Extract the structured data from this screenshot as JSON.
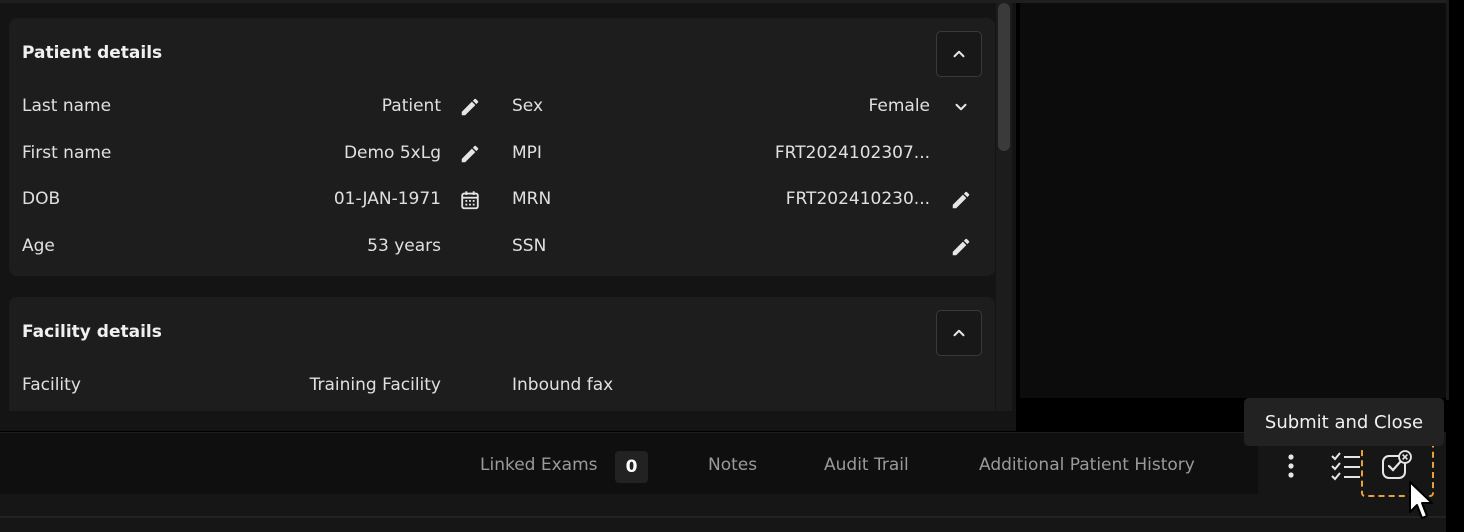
{
  "patient_details": {
    "title": "Patient details",
    "rows": [
      {
        "label": "Last name",
        "value": "Patient",
        "label2": "Sex",
        "value2": "Female"
      },
      {
        "label": "First name",
        "value": "Demo 5xLg",
        "label2": "MPI",
        "value2": "FRT2024102307..."
      },
      {
        "label": "DOB",
        "value": "01-JAN-1971",
        "label2": "MRN",
        "value2": "FRT202410230..."
      },
      {
        "label": "Age",
        "value": "53 years",
        "label2": "SSN",
        "value2": ""
      }
    ]
  },
  "facility_details": {
    "title": "Facility details",
    "rows": [
      {
        "label": "Facility",
        "value": "Training Facility",
        "label2": "Inbound fax"
      }
    ]
  },
  "bottom_bar": {
    "tabs": {
      "linked_exams": "Linked Exams",
      "linked_exams_count": "0",
      "notes": "Notes",
      "audit_trail": "Audit Trail",
      "additional_history": "Additional Patient History"
    },
    "tooltip": "Submit and Close"
  },
  "icons": {
    "edit": "pencil-icon",
    "calendar": "calendar-icon",
    "dropdown": "chevron-down-icon",
    "collapse": "chevron-up-icon",
    "more": "more-vertical-icon",
    "checklist": "checklist-icon",
    "submit_close": "submit-close-icon"
  },
  "colors": {
    "focus_outline": "#e8a13a",
    "card_bg": "#1d1d1d",
    "muted_text": "#9a9a9a"
  }
}
